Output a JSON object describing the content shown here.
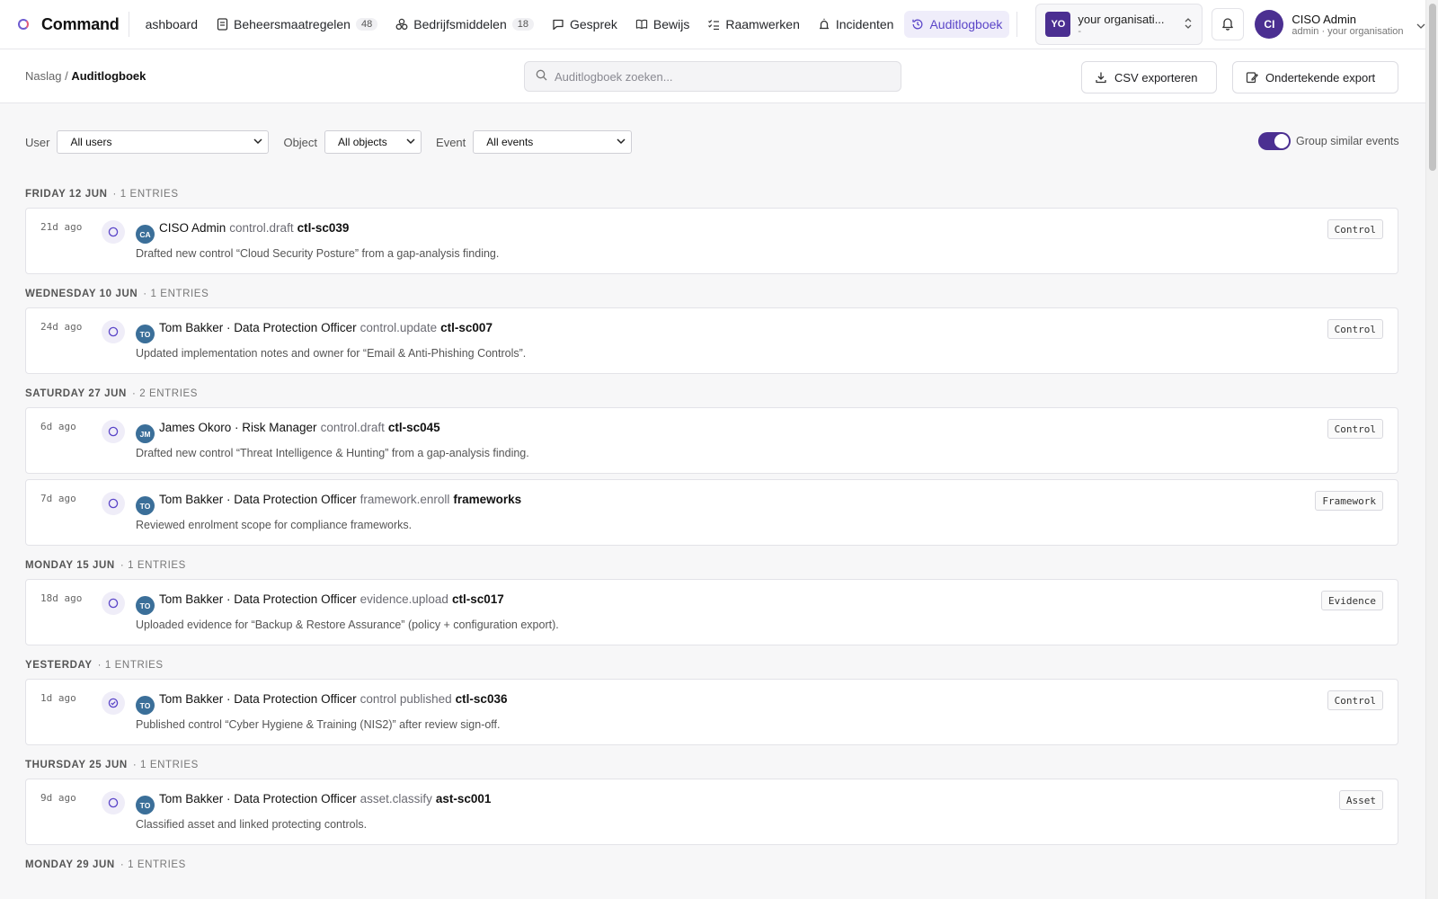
{
  "app": {
    "title": "Command"
  },
  "nav": {
    "items": [
      {
        "label": "ashboard"
      },
      {
        "label": "Beheersmaatregelen",
        "count": "48"
      },
      {
        "label": "Bedrijfsmiddelen",
        "count": "18"
      },
      {
        "label": "Gesprek"
      },
      {
        "label": "Bewijs"
      },
      {
        "label": "Raamwerken"
      },
      {
        "label": "Incidenten"
      },
      {
        "label": "Auditlogboek"
      }
    ]
  },
  "org": {
    "badge": "YO",
    "name": "your organisati...",
    "sub": "-"
  },
  "user": {
    "initials": "CI",
    "name": "CISO Admin",
    "role": "admin · your organisation"
  },
  "breadcrumb": {
    "parent": "Naslag",
    "sep": "/",
    "current": "Auditlogboek"
  },
  "search": {
    "placeholder": "Auditlogboek zoeken..."
  },
  "actions": {
    "csv": "CSV exporteren",
    "signed": "Ondertekende export"
  },
  "filters": {
    "user_label": "User",
    "user_value": "All users",
    "object_label": "Object",
    "object_value": "All objects",
    "event_label": "Event",
    "event_value": "All events",
    "group_label": "Group similar events",
    "group_on": true
  },
  "groups": [
    {
      "day": "FRIDAY 12 JUN",
      "count": "· 1 ENTRIES",
      "entries": [
        {
          "time": "21d ago",
          "initials": "CA",
          "actor": "CISO Admin",
          "action": "control.draft",
          "object": "ctl-sc039",
          "desc": "Drafted new control “Cloud Security Posture” from a gap-analysis finding.",
          "tag": "Control",
          "icon": "circle-icon"
        }
      ]
    },
    {
      "day": "WEDNESDAY 10 JUN",
      "count": "· 1 ENTRIES",
      "entries": [
        {
          "time": "24d ago",
          "initials": "TO",
          "actor": "Tom Bakker · Data Protection Officer",
          "action": "control.update",
          "object": "ctl-sc007",
          "desc": "Updated implementation notes and owner for “Email & Anti-Phishing Controls”.",
          "tag": "Control",
          "icon": "circle-icon"
        }
      ]
    },
    {
      "day": "SATURDAY 27 JUN",
      "count": "· 2 ENTRIES",
      "entries": [
        {
          "time": "6d ago",
          "initials": "JM",
          "actor": "James Okoro · Risk Manager",
          "action": "control.draft",
          "object": "ctl-sc045",
          "desc": "Drafted new control “Threat Intelligence & Hunting” from a gap-analysis finding.",
          "tag": "Control",
          "icon": "circle-icon"
        },
        {
          "time": "7d ago",
          "initials": "TO",
          "actor": "Tom Bakker · Data Protection Officer",
          "action": "framework.enroll",
          "object": "frameworks",
          "desc": "Reviewed enrolment scope for compliance frameworks.",
          "tag": "Framework",
          "icon": "circle-icon"
        }
      ]
    },
    {
      "day": "MONDAY 15 JUN",
      "count": "· 1 ENTRIES",
      "entries": [
        {
          "time": "18d ago",
          "initials": "TO",
          "actor": "Tom Bakker · Data Protection Officer",
          "action": "evidence.upload",
          "object": "ctl-sc017",
          "desc": "Uploaded evidence for “Backup & Restore Assurance” (policy + configuration export).",
          "tag": "Evidence",
          "icon": "circle-icon"
        }
      ]
    },
    {
      "day": "YESTERDAY",
      "count": "· 1 ENTRIES",
      "entries": [
        {
          "time": "1d ago",
          "initials": "TO",
          "actor": "Tom Bakker · Data Protection Officer",
          "action": "control published",
          "object": "ctl-sc036",
          "desc": "Published control “Cyber Hygiene & Training (NIS2)” after review sign-off.",
          "tag": "Control",
          "icon": "circle-check-icon"
        }
      ]
    },
    {
      "day": "THURSDAY 25 JUN",
      "count": "· 1 ENTRIES",
      "entries": [
        {
          "time": "9d ago",
          "initials": "TO",
          "actor": "Tom Bakker · Data Protection Officer",
          "action": "asset.classify",
          "object": "ast-sc001",
          "desc": "Classified asset and linked protecting controls.",
          "tag": "Asset",
          "icon": "circle-icon"
        }
      ]
    },
    {
      "day": "MONDAY 29 JUN",
      "count": "· 1 ENTRIES",
      "entries": []
    }
  ],
  "colors": {
    "accent": "#4b2f91",
    "active_nav": "#5b46c8",
    "avatar": "#3b6f99"
  }
}
